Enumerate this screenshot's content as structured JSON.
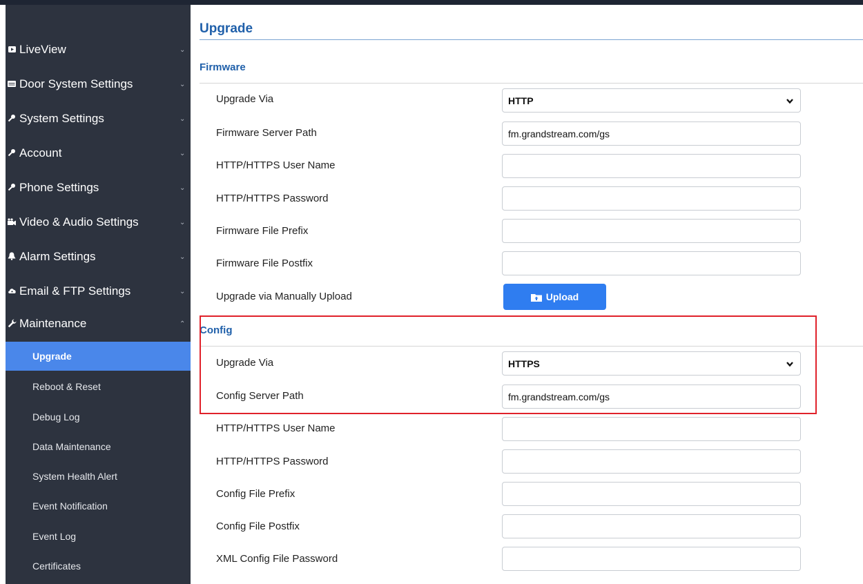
{
  "sidebar": {
    "items": [
      {
        "label": "LiveView",
        "icon": "video-icon",
        "chevron": "⌄"
      },
      {
        "label": "Door System Settings",
        "icon": "panel-icon",
        "chevron": "⌄"
      },
      {
        "label": "System Settings",
        "icon": "key-icon",
        "chevron": "⌄"
      },
      {
        "label": "Account",
        "icon": "key-icon",
        "chevron": "⌄"
      },
      {
        "label": "Phone Settings",
        "icon": "key-icon",
        "chevron": "⌄"
      },
      {
        "label": "Video & Audio Settings",
        "icon": "camera-icon",
        "chevron": "⌄"
      },
      {
        "label": "Alarm Settings",
        "icon": "bell-icon",
        "chevron": "⌄"
      },
      {
        "label": "Email & FTP Settings",
        "icon": "cloud-icon",
        "chevron": "⌄"
      },
      {
        "label": "Maintenance",
        "icon": "wrench-icon",
        "chevron": "⌃"
      }
    ],
    "subitems": [
      {
        "label": "Upgrade",
        "active": true
      },
      {
        "label": "Reboot & Reset"
      },
      {
        "label": "Debug Log"
      },
      {
        "label": "Data Maintenance"
      },
      {
        "label": "System Health Alert"
      },
      {
        "label": "Event Notification"
      },
      {
        "label": "Event Log"
      },
      {
        "label": "Certificates"
      }
    ]
  },
  "page": {
    "title": "Upgrade"
  },
  "firmware": {
    "title": "Firmware",
    "upgrade_via": {
      "label": "Upgrade Via",
      "value": "HTTP"
    },
    "server_path": {
      "label": "Firmware Server Path",
      "value": "fm.grandstream.com/gs"
    },
    "user_name": {
      "label": "HTTP/HTTPS User Name",
      "value": ""
    },
    "password": {
      "label": "HTTP/HTTPS Password",
      "value": ""
    },
    "file_prefix": {
      "label": "Firmware File Prefix",
      "value": ""
    },
    "file_postfix": {
      "label": "Firmware File Postfix",
      "value": ""
    },
    "manual_upload": {
      "label": "Upgrade via Manually Upload",
      "button": "Upload"
    }
  },
  "config": {
    "title": "Config",
    "upgrade_via": {
      "label": "Upgrade Via",
      "value": "HTTPS"
    },
    "server_path": {
      "label": "Config Server Path",
      "value": "fm.grandstream.com/gs"
    },
    "user_name": {
      "label": "HTTP/HTTPS User Name",
      "value": ""
    },
    "password": {
      "label": "HTTP/HTTPS Password",
      "value": ""
    },
    "file_prefix": {
      "label": "Config File Prefix",
      "value": ""
    },
    "file_postfix": {
      "label": "Config File Postfix",
      "value": ""
    },
    "xml_password": {
      "label": "XML Config File Password",
      "value": ""
    }
  },
  "colors": {
    "sidebar_bg": "#2d333f",
    "active_bg": "#4a87ea",
    "title": "#2060aa",
    "button": "#2f7df0",
    "highlight": "#e0212a"
  }
}
